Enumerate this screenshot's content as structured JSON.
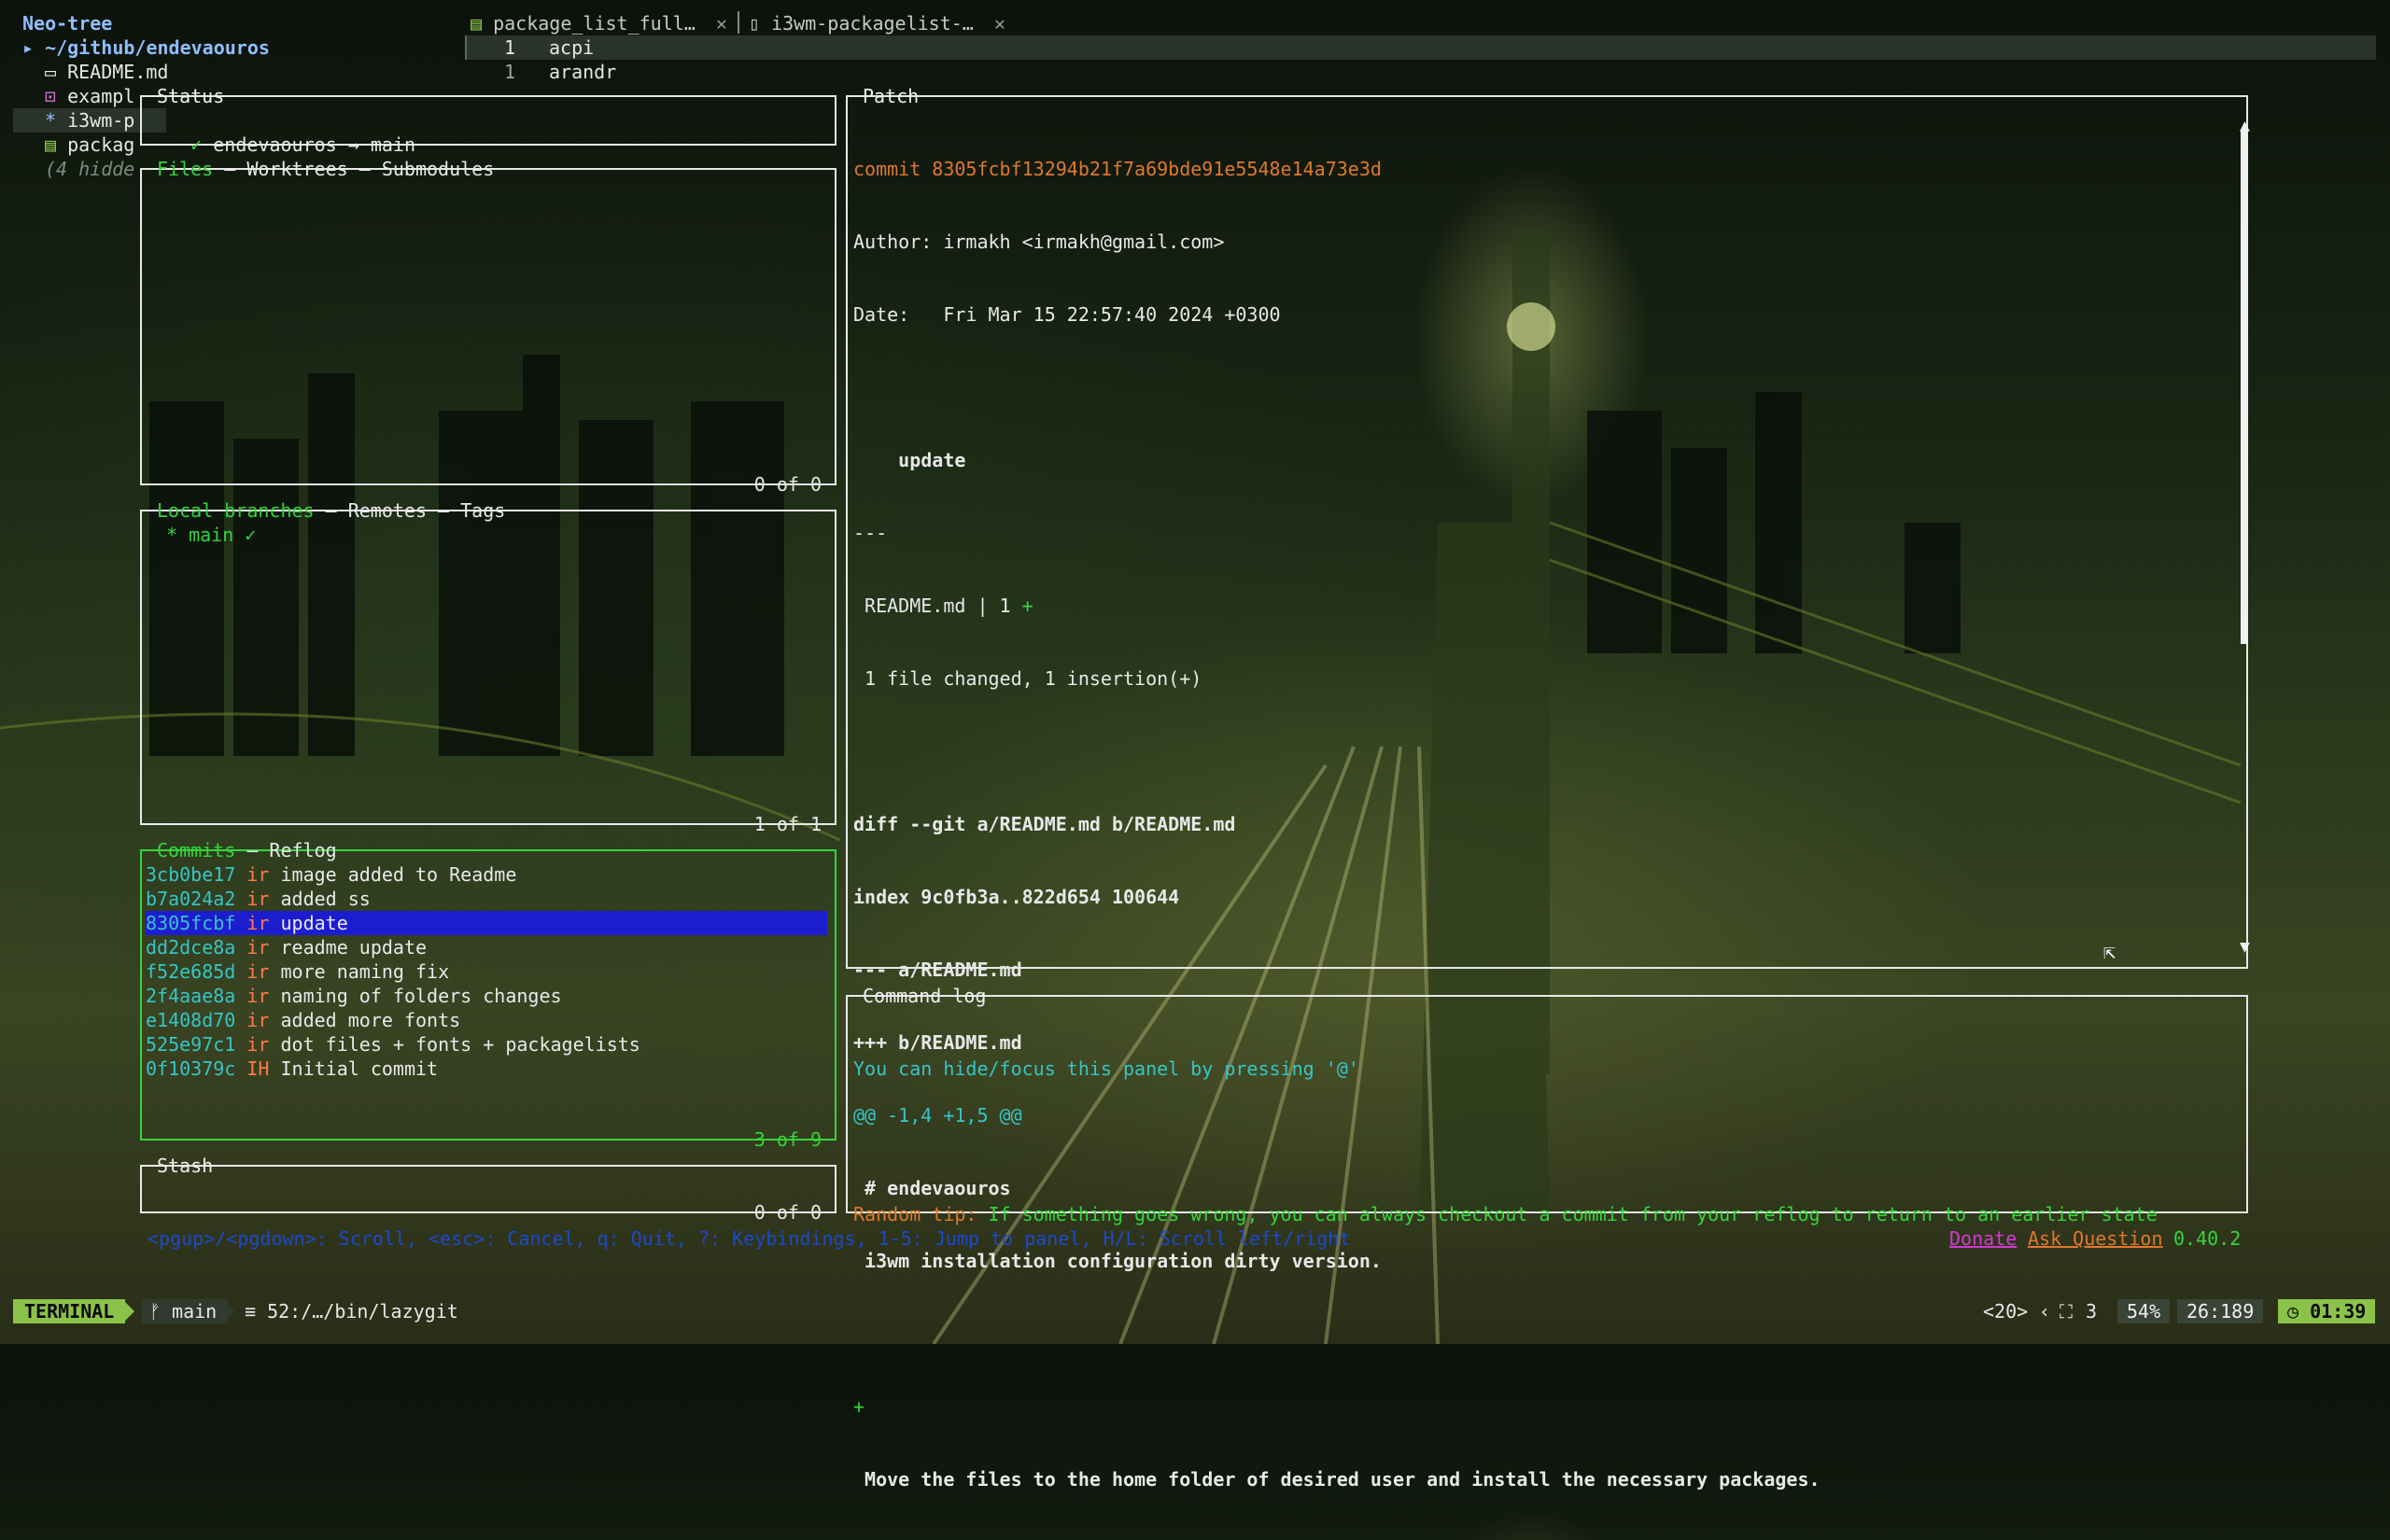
{
  "neotree": {
    "title": "Neo-tree",
    "root": "~/github/endevaouros",
    "items": [
      {
        "icon": "▭",
        "label": "README.md"
      },
      {
        "icon": "⊡",
        "label": "exampl"
      },
      {
        "icon": "*",
        "label": "i3wm-p"
      },
      {
        "icon": "▤",
        "label": "packag"
      }
    ],
    "hidden": "(4 hidde"
  },
  "tabs": [
    {
      "label": "package_list_full…",
      "close": "✕"
    },
    {
      "label": "i3wm-packagelist-…",
      "close": "✕"
    }
  ],
  "buffer": {
    "lines": [
      {
        "num": "1",
        "text": "acpi"
      },
      {
        "num": "1",
        "text": "arandr"
      }
    ]
  },
  "status_panel": {
    "title": "Status",
    "check": "✓",
    "text": "endevaouros → main"
  },
  "files_panel": {
    "tabs": [
      "Files",
      " – ",
      "Worktrees",
      " – ",
      "Submodules"
    ],
    "footer": "0 of 0"
  },
  "branches_panel": {
    "tabs": [
      "Local branches",
      " – ",
      "Remotes",
      " – ",
      "Tags"
    ],
    "current": "* main ✓",
    "footer": "1 of 1"
  },
  "commits_panel": {
    "tabs": [
      "Commits",
      " – ",
      "Reflog"
    ],
    "footer": "3 of 9",
    "rows": [
      {
        "sha": "3cb0be17",
        "author": "ir",
        "msg": "image added to Readme"
      },
      {
        "sha": "b7a024a2",
        "author": "ir",
        "msg": "added ss"
      },
      {
        "sha": "8305fcbf",
        "author": "ir",
        "msg": "update"
      },
      {
        "sha": "dd2dce8a",
        "author": "ir",
        "msg": "readme update"
      },
      {
        "sha": "f52e685d",
        "author": "ir",
        "msg": "more naming fix"
      },
      {
        "sha": "2f4aae8a",
        "author": "ir",
        "msg": "naming of folders changes"
      },
      {
        "sha": "e1408d70",
        "author": "ir",
        "msg": "added more fonts"
      },
      {
        "sha": "525e97c1",
        "author": "ir",
        "msg": "dot files + fonts + packagelists"
      },
      {
        "sha": "0f10379c",
        "author": "IH",
        "msg": "Initial commit"
      }
    ],
    "selected_index": 2
  },
  "stash_panel": {
    "title": "Stash",
    "footer": "0 of 0"
  },
  "patch_panel": {
    "title": "Patch",
    "commit_line": "commit 8305fcbf13294b21f7a69bde91e5548e14a73e3d",
    "author_line": "Author: irmakh <irmakh@gmail.com>",
    "date_line": "Date:   Fri Mar 15 22:57:40 2024 +0300",
    "message": "    update",
    "sep": "---",
    "stat_file": " README.md | 1 ",
    "stat_plus": "+",
    "stat_summary": " 1 file changed, 1 insertion(+)",
    "diff_git": "diff --git a/README.md b/README.md",
    "index_line": "index 9c0fb3a..822d654 100644",
    "minus_file": "--- a/README.md",
    "plus_file": "+++ b/README.md",
    "hunk": "@@ -1,4 +1,5 @@",
    "ctx1": " # endevaouros",
    "ctx2": " i3wm installation configuration dirty version.",
    "added": "+",
    "ctx3": " Move the files to the home folder of desired user and install the necessary packages.",
    "scroll_up": "▲",
    "scroll_down": "▼"
  },
  "command_log": {
    "title": "Command log",
    "line1": "You can hide/focus this panel by pressing '@'",
    "tip_label": "Random tip:",
    "tip_text": " If something goes wrong, you can always checkout a commit from your reflog to return to an earlier state"
  },
  "bottom": {
    "keyhints": "<pgup>/<pgdown>: Scroll, <esc>: Cancel, q: Quit, ?: Keybindings, 1-5: Jump to panel, H/L: Scroll left/right",
    "donate": "Donate",
    "ask": "Ask Question",
    "version": "0.40.2"
  },
  "statusline": {
    "mode": "TERMINAL",
    "branch_icon": "ᚠ",
    "branch": "main",
    "file_icon": "≡",
    "file": "52:/…/bin/lazygit",
    "count": "<20>",
    "lsp_icon": "⛶",
    "lsp_count": "3",
    "percent": "54%",
    "position": "26:189",
    "clock_icon": "◷",
    "time": "01:39"
  },
  "colors": {
    "active_border": "#35d43c",
    "selected_row": "#1d1dd0",
    "sha": "#35c6c6",
    "author": "#ff7a4d",
    "accent_orange": "#e0782c",
    "mode_bg": "#8bc34a"
  }
}
